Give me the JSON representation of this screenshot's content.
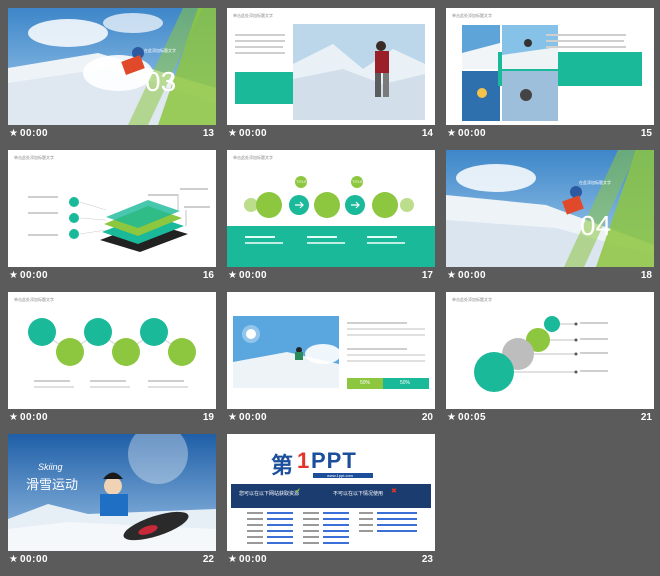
{
  "colors": {
    "teal": "#19b99a",
    "green": "#8dc63f",
    "bg": "#5b5b5b"
  },
  "slides": [
    {
      "number": "13",
      "duration": "00:00",
      "big_number": "03",
      "small_text": "在此添加标题文字",
      "icon": "star-icon"
    },
    {
      "number": "14",
      "duration": "00:00",
      "title": "单击此处添加标题文字",
      "icon": "star-icon"
    },
    {
      "number": "15",
      "duration": "00:00",
      "title": "单击此处添加标题文字",
      "icon": "star-icon"
    },
    {
      "number": "16",
      "duration": "00:00",
      "title": "单击此处添加标题文字",
      "icon": "star-icon"
    },
    {
      "number": "17",
      "duration": "00:00",
      "title": "单击此处添加标题文字",
      "badges": [
        "TITLE",
        "TITLE"
      ],
      "icon": "star-icon"
    },
    {
      "number": "18",
      "duration": "00:00",
      "big_number": "04",
      "small_text": "在此添加标题文字",
      "icon": "star-icon"
    },
    {
      "number": "19",
      "duration": "00:00",
      "title": "单击此处添加标题文字",
      "icon": "star-icon"
    },
    {
      "number": "20",
      "duration": "00:00",
      "bars": [
        "50%",
        "50%"
      ],
      "icon": "star-icon"
    },
    {
      "number": "21",
      "duration": "00:05",
      "title": "单击此处添加标题文字",
      "icon": "star-icon"
    },
    {
      "number": "22",
      "duration": "00:00",
      "title_en": "Skiing",
      "title_cn": "滑雪运动",
      "icon": "star-icon"
    },
    {
      "number": "23",
      "duration": "00:00",
      "logo_first": "第",
      "logo_num": "1",
      "logo_ppt": "PPT",
      "url": "www.1ppt.com",
      "left_heading": "您可以在以下网站获取资源",
      "right_heading": "不可以在以下情况使用"
    }
  ]
}
